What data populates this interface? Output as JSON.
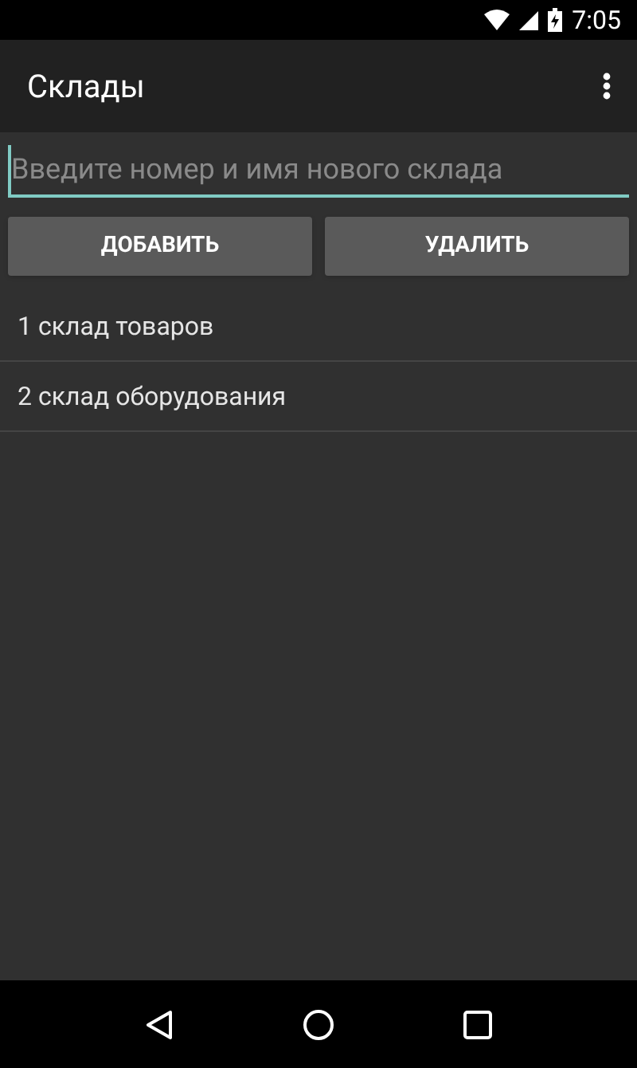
{
  "status_bar": {
    "time": "7:05"
  },
  "app_bar": {
    "title": "Склады"
  },
  "input": {
    "placeholder": "Введите номер и имя нового склада"
  },
  "buttons": [
    "ДОБАВИТЬ",
    "УДАЛИТЬ"
  ],
  "list": [
    "1 склад товаров",
    "2 склад оборудования"
  ]
}
